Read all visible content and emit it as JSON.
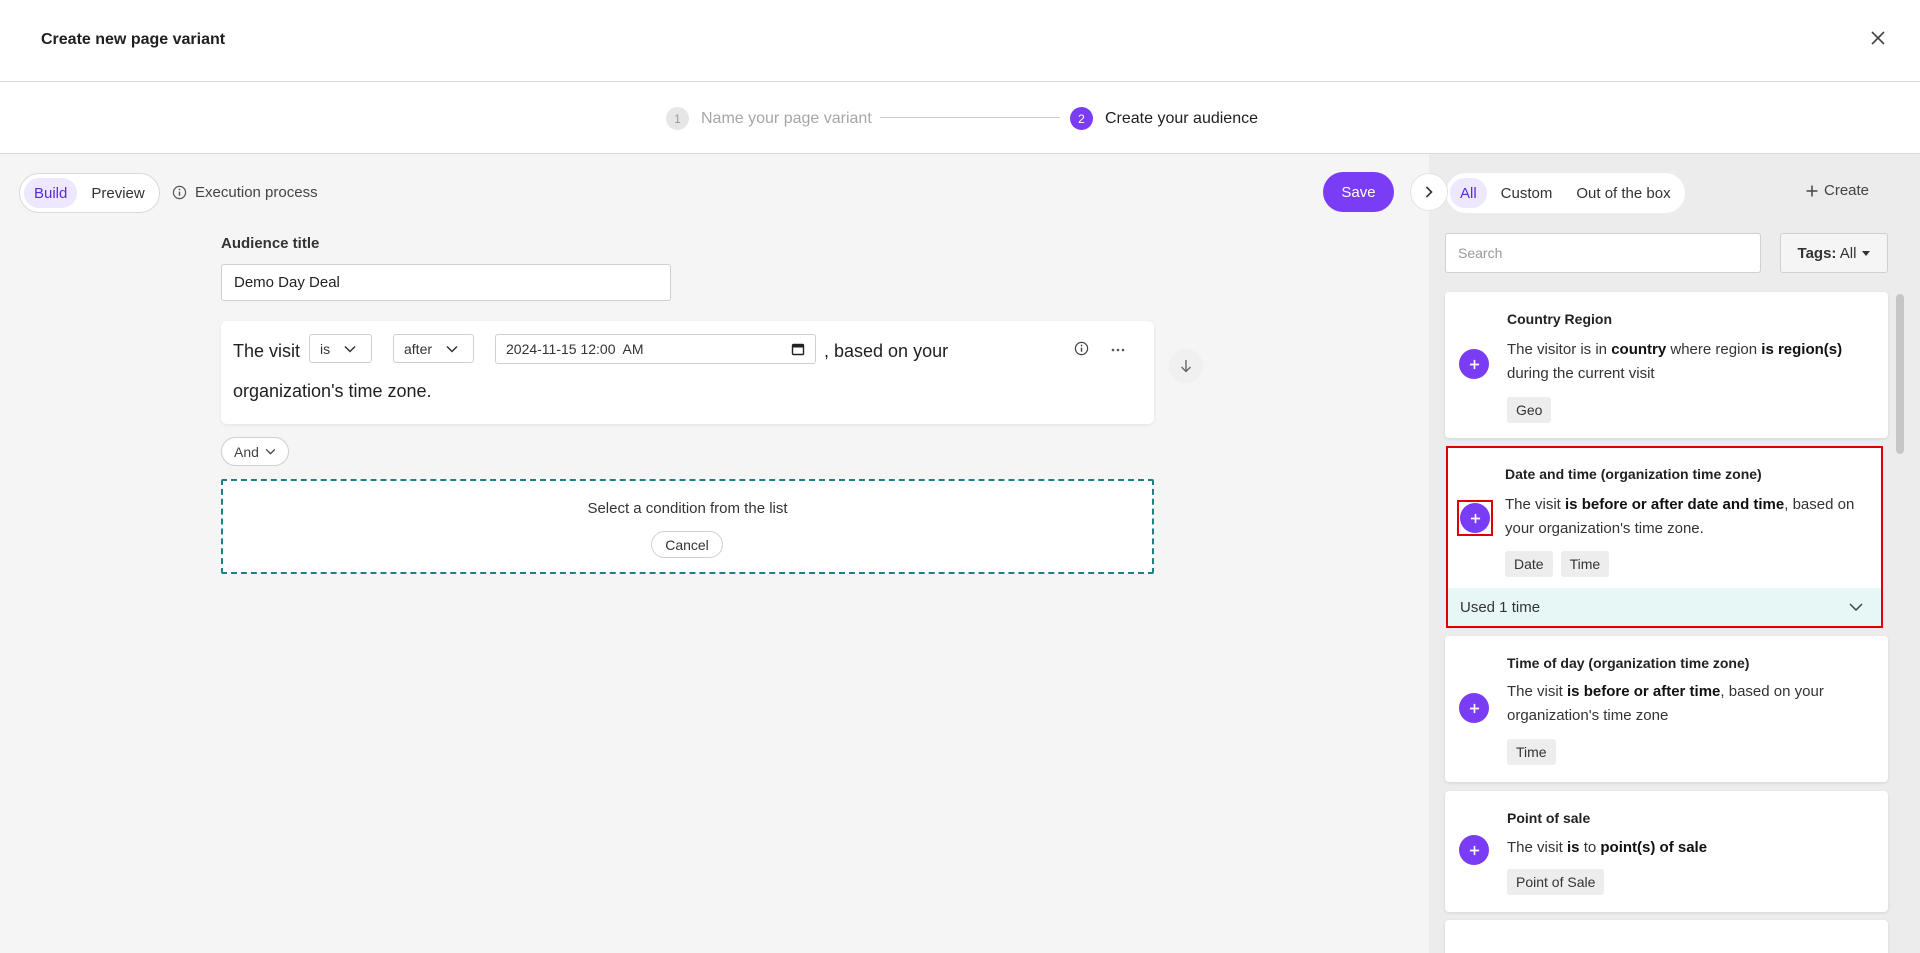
{
  "dialog": {
    "title": "Create new page variant"
  },
  "steps": [
    {
      "number": "1",
      "label": "Name your page variant"
    },
    {
      "number": "2",
      "label": "Create your audience"
    }
  ],
  "toolbar": {
    "build": "Build",
    "preview": "Preview",
    "execution": "Execution process",
    "save": "Save"
  },
  "audience": {
    "label": "Audience title",
    "value": "Demo Day Deal"
  },
  "condition": {
    "prefix": "The visit",
    "operator": "is",
    "comparison": "after",
    "datetime": "2024-11-15 12:00  AM",
    "suffix1": ", based on your",
    "suffix2": "organization's time zone."
  },
  "and_button": "And",
  "drop_zone": {
    "message": "Select a condition from the list",
    "cancel": "Cancel"
  },
  "side": {
    "tabs": [
      "All",
      "Custom",
      "Out of the box"
    ],
    "create": "Create",
    "search_placeholder": "Search",
    "tags_label": "Tags:",
    "tags_value": "All",
    "cards": [
      {
        "title": "Country Region",
        "desc": [
          {
            "t": "The visitor is in ",
            "b": false
          },
          {
            "t": "country",
            "b": true
          },
          {
            "t": " where region ",
            "b": false
          },
          {
            "t": "is region(s)",
            "b": true
          },
          {
            "t": " during the current visit",
            "b": false
          }
        ],
        "tags": [
          "Geo"
        ]
      },
      {
        "title": "Date and time (organization time zone)",
        "desc": [
          {
            "t": "The visit ",
            "b": false
          },
          {
            "t": "is before or after date and time",
            "b": true
          },
          {
            "t": ", based on your organization's time zone.",
            "b": false
          }
        ],
        "tags": [
          "Date",
          "Time"
        ],
        "used": "Used 1 time"
      },
      {
        "title": "Time of day (organization time zone)",
        "desc": [
          {
            "t": "The visit ",
            "b": false
          },
          {
            "t": "is before or after time",
            "b": true
          },
          {
            "t": ", based on your organization's time zone",
            "b": false
          }
        ],
        "tags": [
          "Time"
        ]
      },
      {
        "title": "Point of sale",
        "desc": [
          {
            "t": "The visit ",
            "b": false
          },
          {
            "t": "is",
            "b": true
          },
          {
            "t": " to ",
            "b": false
          },
          {
            "t": "point(s) of sale",
            "b": true
          }
        ],
        "tags": [
          "Point of Sale"
        ]
      }
    ]
  },
  "colors": {
    "accent": "#7a3cf5",
    "highlight": "#e00000",
    "dropzone_border": "#1e7f86",
    "used_bg": "#e6f7f5"
  }
}
